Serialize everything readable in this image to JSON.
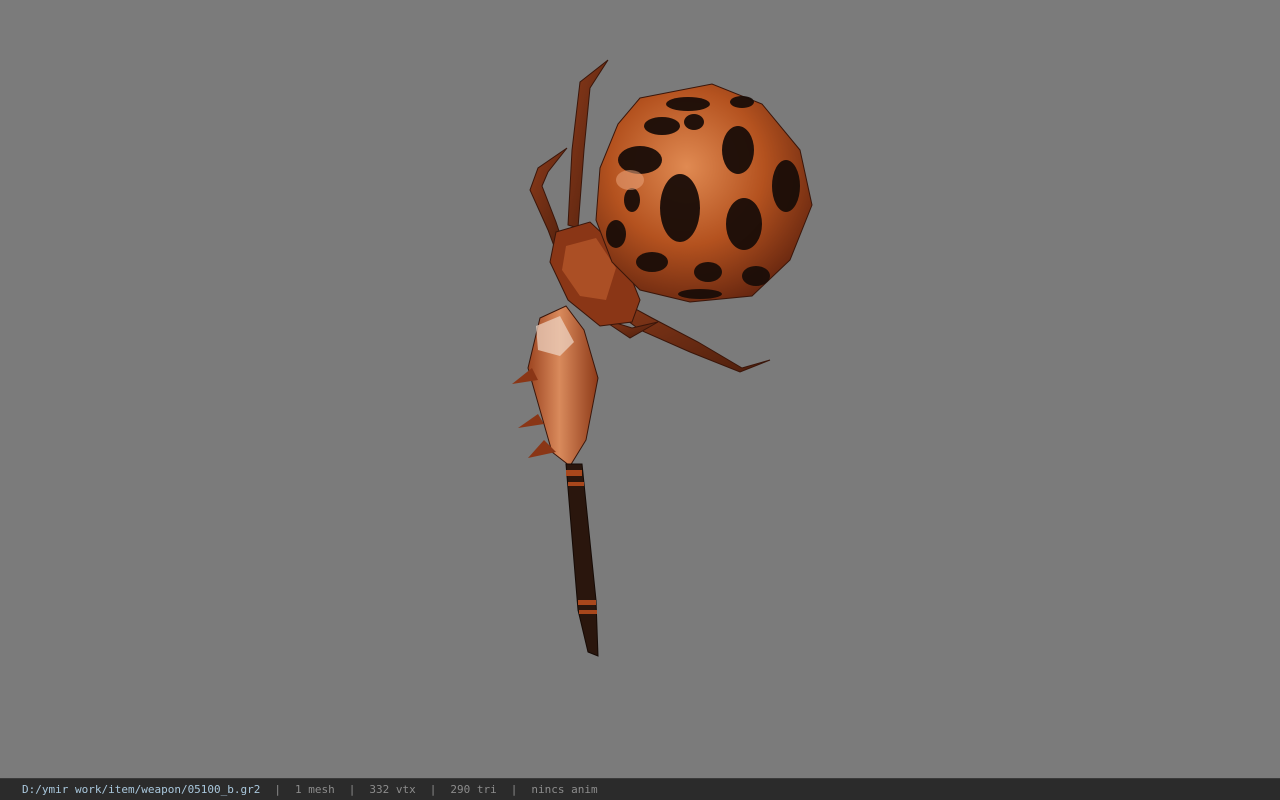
{
  "viewer": {
    "background_color": "#7b7b7b",
    "model_colors": {
      "body": "#a8471c",
      "body_light": "#d0703a",
      "spots": "#1a0d08",
      "legs": "#6e2c14",
      "handle": "#1f110b"
    }
  },
  "status": {
    "file_path": "D:/ymir work/item/weapon/05100_b.gr2",
    "separator": "|",
    "mesh_count": "1 mesh",
    "vertex_count": "332 vtx",
    "triangle_count": "290 tri",
    "animation": "nincs anim"
  }
}
